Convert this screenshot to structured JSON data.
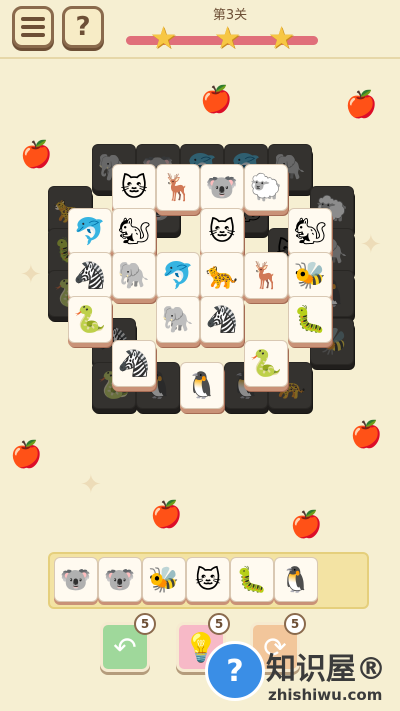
{
  "header": {
    "level_title": "第3关",
    "help_symbol": "?",
    "progress_fraction": 1.0,
    "stars_earned": 3
  },
  "board": {
    "tiles_dim": [
      {
        "a": "elephant-icon",
        "g": "🐘"
      },
      {
        "a": "koala-icon",
        "g": "🐨"
      },
      {
        "a": "dolphin-icon",
        "g": "🐬"
      },
      {
        "a": "dolphin-icon",
        "g": "🐬"
      },
      {
        "a": "elephant-icon",
        "g": "🐘"
      },
      {
        "a": "leopard-icon",
        "g": "🐆"
      },
      {
        "a": "sheep-icon",
        "g": "🐑"
      },
      {
        "a": "koala-icon",
        "g": "🐨"
      },
      {
        "a": "squirrel-icon",
        "g": "🐿"
      },
      {
        "a": "caterpillar-icon",
        "g": "🐛"
      },
      {
        "a": "zebra-icon",
        "g": "🦓"
      },
      {
        "a": "cat-icon",
        "g": "🐱"
      },
      {
        "a": "elephant-icon",
        "g": "🐘"
      },
      {
        "a": "snake-icon",
        "g": "🐍"
      },
      {
        "a": "penguin-icon",
        "g": "🐧"
      },
      {
        "a": "zebra-icon",
        "g": "🦓"
      },
      {
        "a": "bee-icon",
        "g": "🐝"
      },
      {
        "a": "snake-icon",
        "g": "🐍"
      },
      {
        "a": "penguin-icon",
        "g": "🐧"
      },
      {
        "a": "penguin-icon",
        "g": "🐧"
      },
      {
        "a": "leopard-icon",
        "g": "🐆"
      }
    ],
    "tiles_active": [
      {
        "a": "cat-icon",
        "g": "🐱"
      },
      {
        "a": "deer-icon",
        "g": "🦌"
      },
      {
        "a": "koala-icon",
        "g": "🐨"
      },
      {
        "a": "sheep-icon",
        "g": "🐑"
      },
      {
        "a": "dolphin-icon",
        "g": "🐬"
      },
      {
        "a": "squirrel-icon",
        "g": "🐿"
      },
      {
        "a": "cat-icon",
        "g": "🐱"
      },
      {
        "a": "squirrel-icon",
        "g": "🐿"
      },
      {
        "a": "zebra-icon",
        "g": "🦓"
      },
      {
        "a": "elephant-icon",
        "g": "🐘"
      },
      {
        "a": "dolphin-icon",
        "g": "🐬"
      },
      {
        "a": "leopard-icon",
        "g": "🐆"
      },
      {
        "a": "deer-icon",
        "g": "🦌"
      },
      {
        "a": "bee-icon",
        "g": "🐝"
      },
      {
        "a": "snake-icon",
        "g": "🐍"
      },
      {
        "a": "elephant-icon",
        "g": "🐘"
      },
      {
        "a": "zebra-icon",
        "g": "🦓"
      },
      {
        "a": "caterpillar-icon",
        "g": "🐛"
      },
      {
        "a": "zebra-icon",
        "g": "🦓"
      },
      {
        "a": "snake-icon",
        "g": "🐍"
      },
      {
        "a": "penguin-icon",
        "g": "🐧"
      }
    ]
  },
  "tray": {
    "tiles": [
      {
        "a": "koala-icon",
        "g": "🐨"
      },
      {
        "a": "koala-icon",
        "g": "🐨"
      },
      {
        "a": "bee-icon",
        "g": "🐝"
      },
      {
        "a": "cat-icon",
        "g": "🐱"
      },
      {
        "a": "caterpillar-icon",
        "g": "🐛"
      },
      {
        "a": "penguin-icon",
        "g": "🐧"
      }
    ]
  },
  "powerups": {
    "undo": {
      "count": "5",
      "icon": "undo-arrow-icon",
      "glyph": "↶"
    },
    "hint": {
      "count": "5",
      "icon": "lightbulb-icon",
      "glyph": "💡"
    },
    "shuffle": {
      "count": "5",
      "icon": "shuffle-icon",
      "glyph": "⟳"
    }
  },
  "watermark": {
    "brand": "知识屋®",
    "domain": "zhishiwu.com",
    "glyph": "?"
  },
  "colors": {
    "background": "#f6efd2",
    "tile_face": "#fffaf0",
    "tile_edge": "#c99277",
    "progress_fill": "#e06f7a",
    "star": "#f7c744"
  }
}
